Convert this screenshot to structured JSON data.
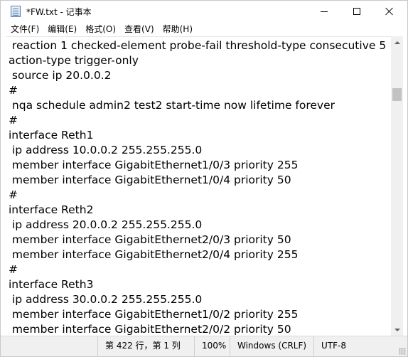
{
  "window": {
    "title": "*FW.txt - 记事本",
    "icon": "notepad-icon"
  },
  "menu": {
    "items": [
      {
        "label": "文件(F)"
      },
      {
        "label": "编辑(E)"
      },
      {
        "label": "格式(O)"
      },
      {
        "label": "查看(V)"
      },
      {
        "label": "帮助(H)"
      }
    ]
  },
  "editor": {
    "lines": [
      " reaction 1 checked-element probe-fail threshold-type consecutive 5",
      "action-type trigger-only",
      " source ip 20.0.0.2",
      "#",
      " nqa schedule admin2 test2 start-time now lifetime forever",
      "#",
      "interface Reth1",
      " ip address 10.0.0.2 255.255.255.0",
      " member interface GigabitEthernet1/0/3 priority 255",
      " member interface GigabitEthernet1/0/4 priority 50",
      "#",
      "interface Reth2",
      " ip address 20.0.0.2 255.255.255.0",
      " member interface GigabitEthernet2/0/3 priority 50",
      " member interface GigabitEthernet2/0/4 priority 255",
      "#",
      "interface Reth3",
      " ip address 30.0.0.2 255.255.255.0",
      " member interface GigabitEthernet1/0/2 priority 255",
      " member interface GigabitEthernet2/0/2 priority 50"
    ]
  },
  "status": {
    "position": "第 422 行，第 1 列",
    "zoom": "100%",
    "line_ending": "Windows (CRLF)",
    "encoding": "UTF-8"
  }
}
